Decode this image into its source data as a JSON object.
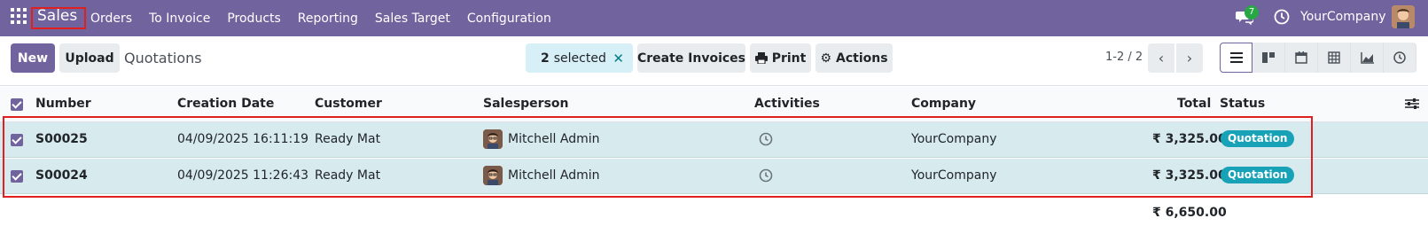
{
  "navbar": {
    "brand": "Sales",
    "menu": [
      "Orders",
      "To Invoice",
      "Products",
      "Reporting",
      "Sales Target",
      "Configuration"
    ],
    "chat_count": "7",
    "company": "YourCompany",
    "colors": {
      "bar": "#71639e",
      "highlight": "#e02020"
    }
  },
  "control": {
    "new_label": "New",
    "upload_label": "Upload",
    "title": "Quotations",
    "selected_count": "2",
    "selected_label": "selected",
    "create_invoices_label": "Create Invoices",
    "print_label": "Print",
    "actions_label": "Actions",
    "pager": "1-2 / 2",
    "views": [
      "list-view-icon",
      "kanban-view-icon",
      "calendar-view-icon",
      "pivot-view-icon",
      "graph-view-icon",
      "activity-view-icon"
    ],
    "active_view": "list-view-icon"
  },
  "table": {
    "headers": {
      "number": "Number",
      "creation_date": "Creation Date",
      "customer": "Customer",
      "salesperson": "Salesperson",
      "activities": "Activities",
      "company": "Company",
      "total": "Total",
      "status": "Status"
    },
    "rows": [
      {
        "number": "S00025",
        "creation_date": "04/09/2025 16:11:19",
        "customer": "Ready Mat",
        "salesperson": "Mitchell Admin",
        "company": "YourCompany",
        "total": "₹ 3,325.00",
        "status": "Quotation"
      },
      {
        "number": "S00024",
        "creation_date": "04/09/2025 11:26:43",
        "customer": "Ready Mat",
        "salesperson": "Mitchell Admin",
        "company": "YourCompany",
        "total": "₹ 3,325.00",
        "status": "Quotation"
      }
    ],
    "sum_total": "₹ 6,650.00",
    "colors": {
      "row_selected": "#d7ebee",
      "badge": "#17a2b8"
    }
  }
}
